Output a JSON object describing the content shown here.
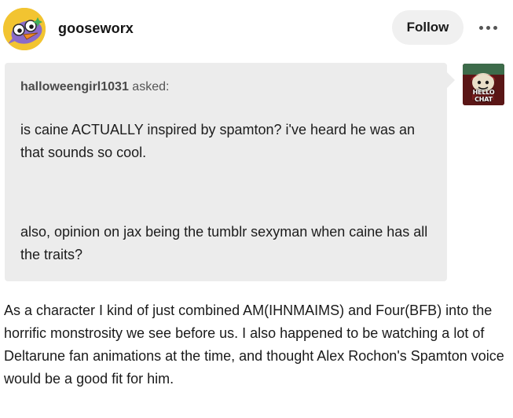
{
  "header": {
    "blog_name": "gooseworx",
    "follow_label": "Follow",
    "more_icon": "more-horizontal-icon"
  },
  "ask": {
    "asker_name": "halloweengirl1031",
    "asked_suffix": " asked:",
    "question_paragraphs": [
      "is caine ACTUALLY inspired by spamton? i've heard he was an that sounds so cool.",
      "also, opinion on jax being the tumblr sexyman when caine has all the traits?"
    ],
    "asker_avatar_caption": "HELLO CHAT"
  },
  "answer": {
    "text": "As a character I kind of just combined AM(IHNMAIMS) and Four(BFB) into the horrific monstrosity we see before us. I also happened to be watching a lot of Deltarune fan animations at the time, and thought Alex Rochon's Spamton voice would be a good fit for him."
  },
  "colors": {
    "ask_background": "#ececec",
    "follow_button_background": "#f0f0f0",
    "avatar_background": "#f2c431"
  }
}
